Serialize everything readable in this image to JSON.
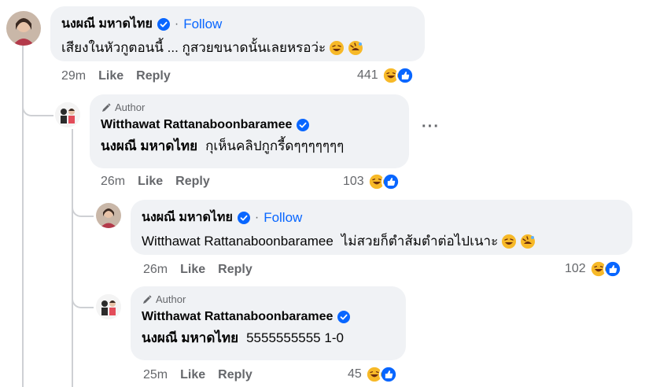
{
  "comments": [
    {
      "author": "นงผณี มหาดไทย",
      "follow_label": "Follow",
      "separator": "·",
      "text": "เสียงในหัวกูตอนนี้ ... กูสวยขนาดนั้นเลยหรอว่ะ",
      "time": "29m",
      "like_label": "Like",
      "reply_label": "Reply",
      "reaction_count": "441"
    },
    {
      "author_tag": "Author",
      "author": "Witthawat Rattanaboonbaramee",
      "mention": "นงผณี มหาดไทย",
      "text": "กุเห็นคลิปกูกรี้ดๆๆๆๆๆๆๆ",
      "time": "26m",
      "like_label": "Like",
      "reply_label": "Reply",
      "reaction_count": "103",
      "more_label": "···"
    },
    {
      "author": "นงผณี มหาดไทย",
      "follow_label": "Follow",
      "separator": "·",
      "mention": "Witthawat Rattanaboonbaramee",
      "text": "ไม่สวยก็ตำส้มตำต่อไปเนาะ",
      "time": "26m",
      "like_label": "Like",
      "reply_label": "Reply",
      "reaction_count": "102"
    },
    {
      "author_tag": "Author",
      "author": "Witthawat Rattanaboonbaramee",
      "mention": "นงผณี มหาดไทย",
      "text": "5555555555 1-0",
      "time": "25m",
      "like_label": "Like",
      "reply_label": "Reply",
      "reaction_count": "45"
    }
  ],
  "icons": {
    "verified": "verified-badge-icon",
    "haha": "haha-reaction-icon",
    "like": "like-reaction-icon",
    "rofl": "rolling-laughing-emoji-icon",
    "joy": "grinning-sweat-emoji-icon",
    "author": "pencil-author-icon"
  },
  "colors": {
    "link": "#0866ff",
    "bubble": "#f0f2f5",
    "muted": "#65676b",
    "haha": "#f7b928",
    "like": "#0866ff"
  }
}
